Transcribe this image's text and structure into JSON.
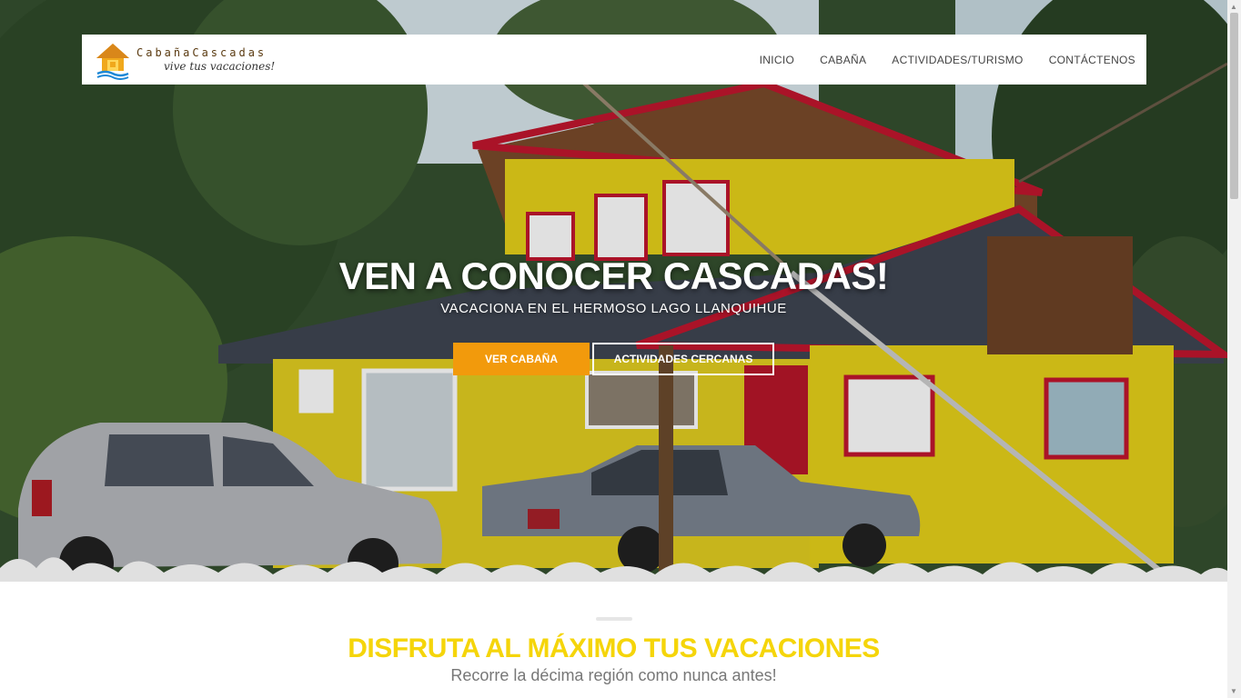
{
  "brand": {
    "name": "CabañaCascadas",
    "tagline": "vive tus vacaciones!"
  },
  "nav": {
    "items": [
      {
        "label": "INICIO"
      },
      {
        "label": "CABAÑA"
      },
      {
        "label": "ACTIVIDADES/TURISMO"
      },
      {
        "label": "CONTÁCTENOS"
      }
    ]
  },
  "hero": {
    "title": "VEN A CONOCER CASCADAS!",
    "subtitle": "VACACIONA EN EL HERMOSO LAGO LLANQUIHUE",
    "primary_button": "VER CABAÑA",
    "secondary_button": "ACTIVIDADES CERCANAS"
  },
  "section": {
    "title": "DISFRUTA AL MÁXIMO TUS VACACIONES",
    "subtitle": "Recorre la décima región como nunca antes!"
  },
  "colors": {
    "accent_orange": "#f29a0c",
    "title_yellow": "#f5d50a",
    "house_yellow": "#e8d21a",
    "house_red": "#c2162e"
  }
}
